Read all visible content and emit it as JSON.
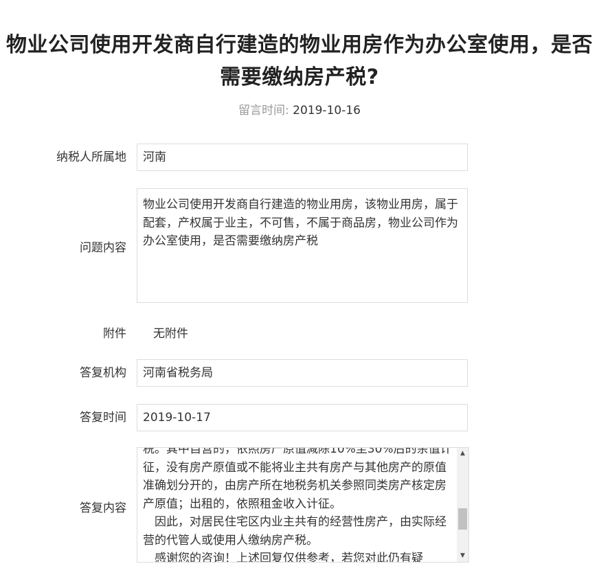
{
  "page": {
    "title_line1": "物业公司使用开发商自行建造的物业用房作为办公室使用，是否",
    "title_line2": "需要缴纳房产税?",
    "post_time_label": "留言时间:",
    "post_time_value": "2019-10-16"
  },
  "form": {
    "taxpayer_location_label": "纳税人所属地",
    "taxpayer_location_value": "河南",
    "question_label": "问题内容",
    "question_value": "物业公司使用开发商自行建造的物业用房，该物业用房，属于配套，产权属于业主，不可售，不属于商品房，物业公司作为办公室使用，是否需要缴纳房产税",
    "attachment_label": "附件",
    "attachment_value": "无附件",
    "reply_org_label": "答复机构",
    "reply_org_value": "河南省税务局",
    "reply_time_label": "答复时间",
    "reply_time_value": "2019-10-17",
    "reply_content_label": "答复内容",
    "reply_content_paragraphs": [
      "税。其中自营的，依照房产原值减除10%至30%后的余值计征，没有房产原值或不能将业主共有房产与其他房产的原值准确划分开的，由房产所在地税务机关参照同类房产核定房产原值；出租的，依照租金收入计征。",
      "　因此，对居民住宅区内业主共有的经营性房产，由实际经营的代管人或使用人缴纳房产税。",
      "　感谢您的咨询！上述回复仅供参考，若您对此仍有疑"
    ]
  },
  "scrollbar": {
    "up_icon": "▲",
    "down_icon": "▼",
    "position_fraction": 0.7
  }
}
